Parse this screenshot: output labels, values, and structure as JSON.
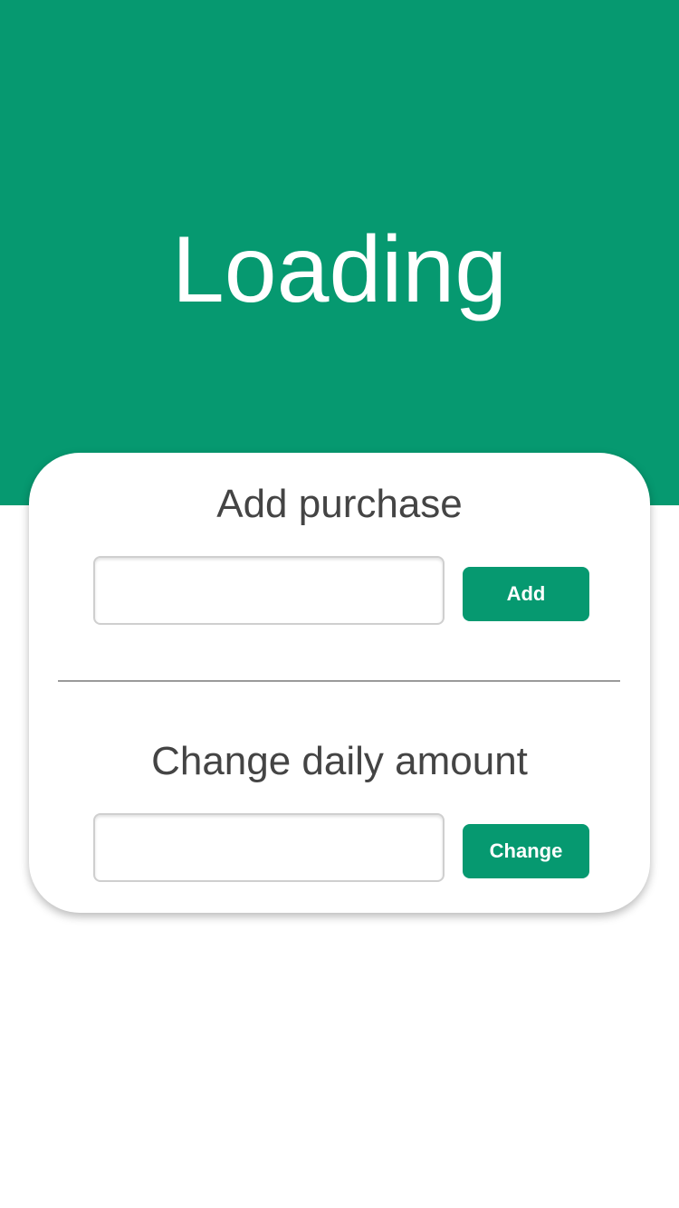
{
  "header": {
    "title": "Loading",
    "background_color": "#069970"
  },
  "purchase": {
    "title": "Add purchase",
    "input_value": "",
    "input_placeholder": "",
    "button_label": "Add"
  },
  "daily_amount": {
    "title": "Change daily amount",
    "input_value": "",
    "input_placeholder": "",
    "button_label": "Change"
  },
  "colors": {
    "accent": "#069970",
    "text": "#444444",
    "button_text": "#ffffff"
  }
}
